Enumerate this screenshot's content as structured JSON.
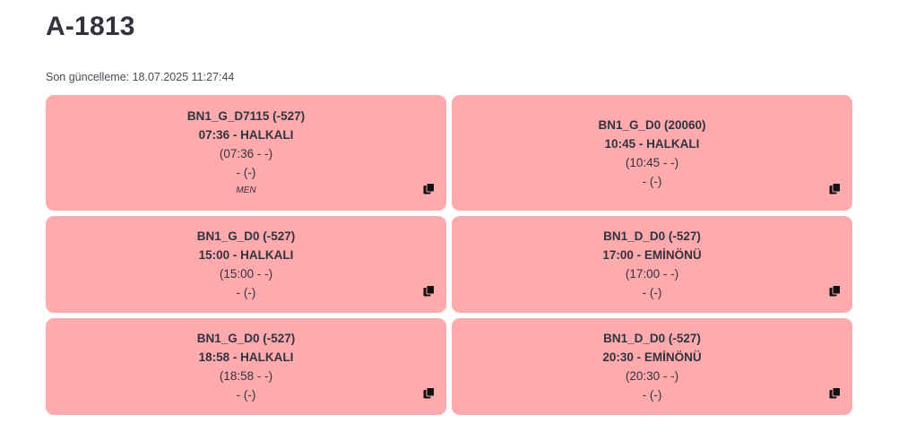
{
  "header": {
    "title": "A-1813",
    "last_update": "Son güncelleme: 18.07.2025 11:27:44"
  },
  "cards": [
    {
      "code": "BN1_G_D7115 (-527)",
      "time_dest": "07:36 - HALKALI",
      "detail": "(07:36 - -)",
      "extra": "- (-)",
      "note": "MEN",
      "icon": "copy-icon"
    },
    {
      "code": "BN1_G_D0 (20060)",
      "time_dest": "10:45 - HALKALI",
      "detail": "(10:45 - -)",
      "extra": "- (-)",
      "icon": "copy-icon"
    },
    {
      "code": "BN1_G_D0 (-527)",
      "time_dest": "15:00 - HALKALI",
      "detail": "(15:00 - -)",
      "extra": "- (-)",
      "icon": "copy-icon"
    },
    {
      "code": "BN1_D_D0 (-527)",
      "time_dest": "17:00 - EMİNÖNÜ",
      "detail": "(17:00 - -)",
      "extra": "- (-)",
      "icon": "copy-icon"
    },
    {
      "code": "BN1_G_D0 (-527)",
      "time_dest": "18:58 - HALKALI",
      "detail": "(18:58 - -)",
      "extra": "- (-)",
      "icon": "copy-icon"
    },
    {
      "code": "BN1_D_D0 (-527)",
      "time_dest": "20:30 - EMİNÖNÜ",
      "detail": "(20:30 - -)",
      "extra": "- (-)",
      "icon": "copy-icon"
    }
  ],
  "colors": {
    "card_background": "#ffabae",
    "text": "#31333f"
  }
}
